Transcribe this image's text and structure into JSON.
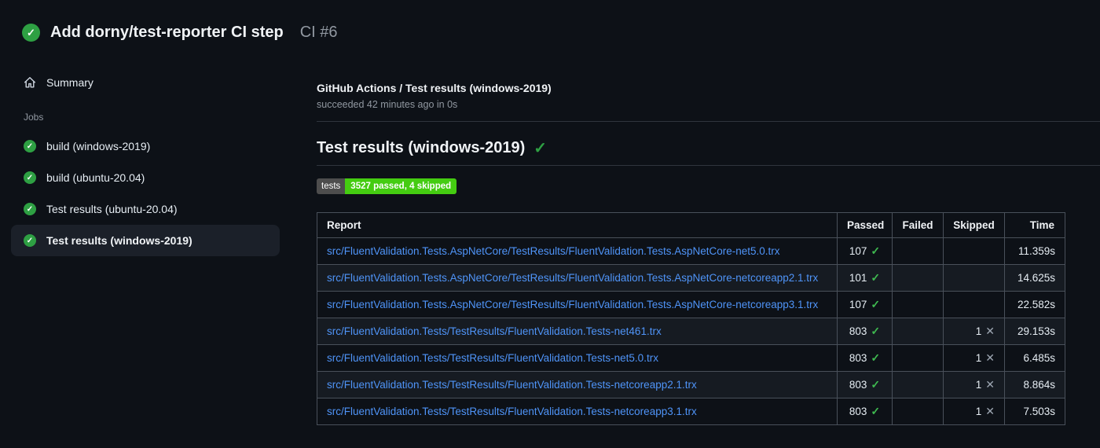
{
  "header": {
    "title": "Add dorny/test-reporter CI step",
    "run_number": "CI #6",
    "status": "success"
  },
  "sidebar": {
    "summary_label": "Summary",
    "jobs_label": "Jobs",
    "jobs": [
      {
        "label": "build (windows-2019)",
        "status": "success",
        "selected": false
      },
      {
        "label": "build (ubuntu-20.04)",
        "status": "success",
        "selected": false
      },
      {
        "label": "Test results (ubuntu-20.04)",
        "status": "success",
        "selected": false
      },
      {
        "label": "Test results (windows-2019)",
        "status": "success",
        "selected": true
      }
    ]
  },
  "main": {
    "run_title": "GitHub Actions / Test results (windows-2019)",
    "run_status": "succeeded 42 minutes ago in 0s",
    "section_title": "Test results (windows-2019)",
    "section_status": "success",
    "badge": {
      "label": "tests",
      "value": "3527 passed, 4 skipped",
      "label_bg": "#4d4d4d",
      "value_bg": "#44cc11"
    },
    "table": {
      "headers": [
        "Report",
        "Passed",
        "Failed",
        "Skipped",
        "Time"
      ],
      "rows": [
        {
          "report": "src/FluentValidation.Tests.AspNetCore/TestResults/FluentValidation.Tests.AspNetCore-net5.0.trx",
          "passed": "107",
          "failed": "",
          "skipped": "",
          "time": "11.359s"
        },
        {
          "report": "src/FluentValidation.Tests.AspNetCore/TestResults/FluentValidation.Tests.AspNetCore-netcoreapp2.1.trx",
          "passed": "101",
          "failed": "",
          "skipped": "",
          "time": "14.625s"
        },
        {
          "report": "src/FluentValidation.Tests.AspNetCore/TestResults/FluentValidation.Tests.AspNetCore-netcoreapp3.1.trx",
          "passed": "107",
          "failed": "",
          "skipped": "",
          "time": "22.582s"
        },
        {
          "report": "src/FluentValidation.Tests/TestResults/FluentValidation.Tests-net461.trx",
          "passed": "803",
          "failed": "",
          "skipped": "1",
          "time": "29.153s"
        },
        {
          "report": "src/FluentValidation.Tests/TestResults/FluentValidation.Tests-net5.0.trx",
          "passed": "803",
          "failed": "",
          "skipped": "1",
          "time": "6.485s"
        },
        {
          "report": "src/FluentValidation.Tests/TestResults/FluentValidation.Tests-netcoreapp2.1.trx",
          "passed": "803",
          "failed": "",
          "skipped": "1",
          "time": "8.864s"
        },
        {
          "report": "src/FluentValidation.Tests/TestResults/FluentValidation.Tests-netcoreapp3.1.trx",
          "passed": "803",
          "failed": "",
          "skipped": "1",
          "time": "7.503s"
        }
      ]
    }
  },
  "icons": {
    "check": "✓",
    "cross": "✕"
  },
  "colors": {
    "page_bg": "#0d1117",
    "accent_green": "#2ea043",
    "check_green": "#3fb950",
    "link_blue": "#4f94f8",
    "muted_text": "#9198a1",
    "selected_item_bg": "#1b2029",
    "table_border": "#49505a",
    "table_row_alt_bg": "#161b22",
    "badge_label_bg": "#4d4d4d",
    "badge_value_bg": "#44cc11"
  }
}
